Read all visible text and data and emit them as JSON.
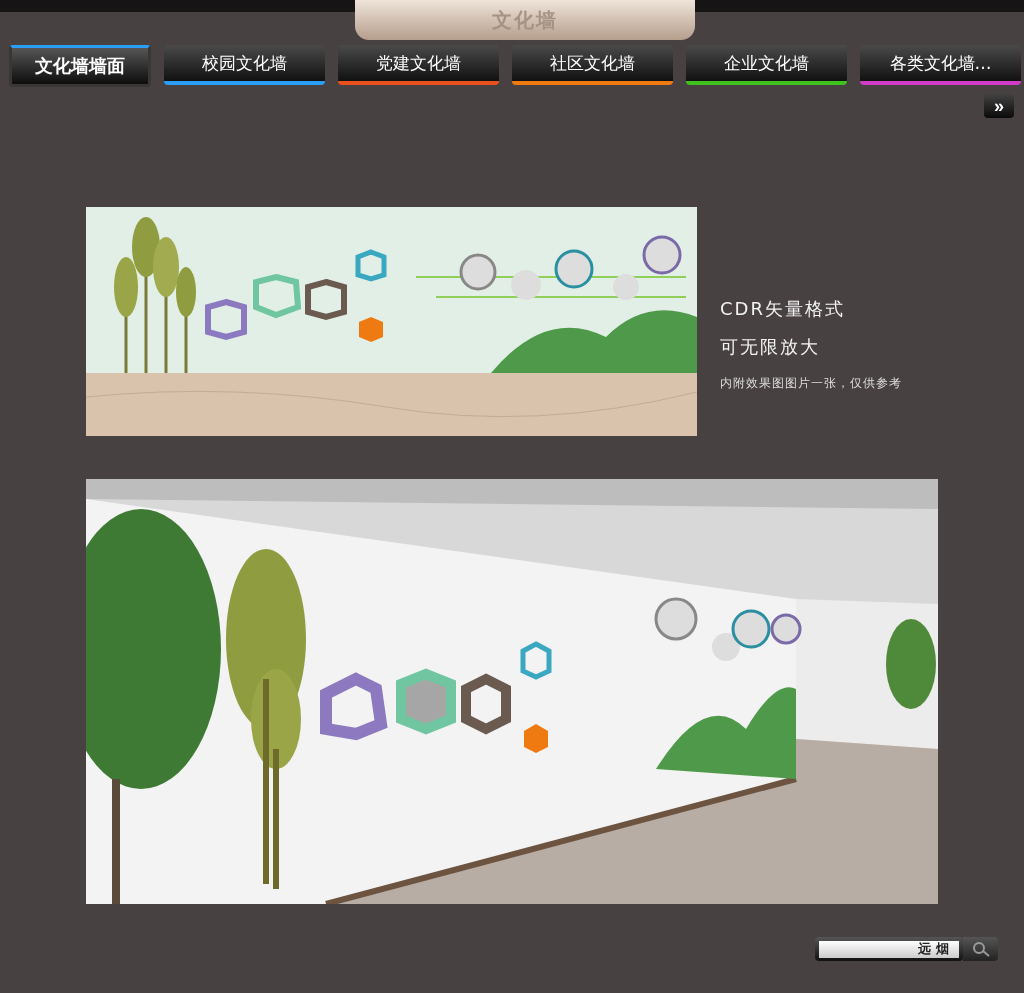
{
  "header": {
    "title": "文化墙"
  },
  "tabs": [
    {
      "label": "文化墙墙面",
      "selected": true,
      "color": "#2a9df4"
    },
    {
      "label": "校园文化墙",
      "selected": false,
      "color": "#2a9df4"
    },
    {
      "label": "党建文化墙",
      "selected": false,
      "color": "#e8501c"
    },
    {
      "label": "社区文化墙",
      "selected": false,
      "color": "#f07a12"
    },
    {
      "label": "企业文化墙",
      "selected": false,
      "color": "#3fc21e"
    },
    {
      "label": "各类文化墙…",
      "selected": false,
      "color": "#d23ac8"
    }
  ],
  "more_button": {
    "label": "»"
  },
  "info": {
    "lines": [
      "CDR矢量格式",
      "可无限放大"
    ],
    "note": "内附效果图图片一张，仅供参考"
  },
  "search": {
    "value": "远 烟"
  }
}
